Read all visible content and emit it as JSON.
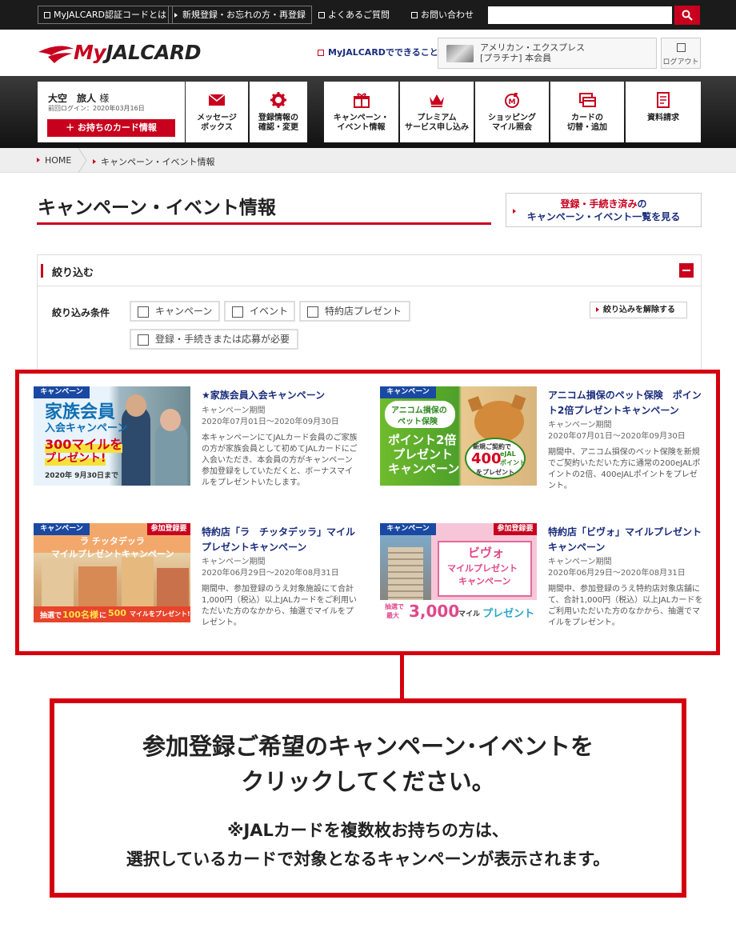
{
  "topbar": {
    "auth_code": "MyJALCARD認証コードとは",
    "register": "新規登録・お忘れの方・再登録",
    "faq": "よくあるご質問",
    "contact": "お問い合わせ",
    "search_placeholder": ""
  },
  "header": {
    "logo_my": "My",
    "logo_jal": "JALCARD",
    "can_do": "MyJALCARDでできること",
    "card_name": "アメリカン・エクスプレス",
    "card_grade": "[プラチナ] 本会員",
    "logout": "ログアウト"
  },
  "user": {
    "name": "大空　旅人",
    "honorific": "様",
    "last_login": "前回ログイン：2020年03月16日",
    "card_info_button": "＋ お持ちのカード情報"
  },
  "nav": [
    {
      "line1": "メッセージ",
      "line2": "ボックス",
      "icon": "envelope-icon"
    },
    {
      "line1": "登録情報の",
      "line2": "確認・変更",
      "icon": "gear-icon"
    },
    {
      "line1": "キャンペーン・",
      "line2": "イベント情報",
      "icon": "gift-icon"
    },
    {
      "line1": "プレミアム",
      "line2": "サービス申し込み",
      "icon": "crown-icon"
    },
    {
      "line1": "ショッピング",
      "line2": "マイル照会",
      "icon": "shopping-bag-icon"
    },
    {
      "line1": "カードの",
      "line2": "切替・追加",
      "icon": "cards-icon"
    },
    {
      "line1": "資料請求",
      "line2": "",
      "icon": "document-icon"
    }
  ],
  "breadcrumb": {
    "home": "HOME",
    "current": "キャンペーン・イベント情報"
  },
  "page": {
    "title": "キャンペーン・イベント情報",
    "registered_link_red": "登録・手続き済み",
    "registered_link_suffix": "の",
    "registered_link_line2": "キャンペーン・イベント一覧を見る"
  },
  "filter": {
    "title": "絞り込む",
    "condition_label": "絞り込み条件",
    "options": [
      "キャンペーン",
      "イベント",
      "特約店プレゼント",
      "登録・手続きまたは応募が必要"
    ],
    "clear_button": "絞り込みを解除する"
  },
  "campaigns": [
    {
      "tag": "キャンペーン",
      "tag_required": "",
      "title": "★家族会員入会キャンペーン",
      "period_label": "キャンペーン期間",
      "period": "2020年07月01日～2020年09月30日",
      "description": "本キャンペーンにてJALカード会員のご家族の方が家族会員として初めてJALカードにご入会いただき、本会員の方がキャンペーン参加登録をしていただくと、ボーナスマイルをプレゼントいたします。",
      "banner": [
        "家族会員",
        "入会キャンペーン",
        "300マイルを",
        "プレゼント!",
        "2020年 9月30日まで"
      ]
    },
    {
      "tag": "キャンペーン",
      "tag_required": "",
      "title": "アニコム損保のペット保険　ポイント2倍プレゼントキャンペーン",
      "period_label": "キャンペーン期間",
      "period": "2020年07月01日～2020年09月30日",
      "description": "期間中、アニコム損保のペット保険を新規でご契約いただいた方に通常の200eJALポイントの2倍、400eJALポイントをプレゼント。",
      "banner": [
        "アニコム損保の",
        "ペット保険",
        "ポイント2倍",
        "プレゼント",
        "キャンペーン",
        "新規ご契約で",
        "400",
        "eJAL",
        "ポイント",
        "をプレゼント"
      ]
    },
    {
      "tag": "キャンペーン",
      "tag_required": "参加登録要",
      "title": "特約店「ラ　チッタデッラ」マイルプレゼントキャンペーン",
      "period_label": "キャンペーン期間",
      "period": "2020年06月29日～2020年08月31日",
      "description": "期間中、参加登録のうえ対象施設にて合計1,000円（税込）以上JALカードをご利用いただいた方のなかから、抽選でマイルをプレゼント。",
      "banner": [
        "ラ チッタデッラ",
        "マイルプレゼントキャンペーン",
        "抽選で",
        "100名様",
        "に",
        "500",
        "マイルをプレゼント!"
      ]
    },
    {
      "tag": "キャンペーン",
      "tag_required": "参加登録要",
      "title": "特約店「ビヴォ」マイルプレゼントキャンペーン",
      "period_label": "キャンペーン期間",
      "period": "2020年06月29日～2020年08月31日",
      "description": "期間中、参加登録のうえ特約店対象店舗にて、合計1,000円（税込）以上JALカードをご利用いただいた方のなかから、抽選でマイルをプレゼント。",
      "banner": [
        "ビヴォ",
        "マイルプレゼント",
        "キャンペーン",
        "抽選で",
        "最大",
        "3,000",
        "マイル",
        "プレゼント"
      ]
    }
  ],
  "note": {
    "line1": "参加登録ご希望のキャンペーン･イベントを",
    "line2": "クリックしてください。",
    "sub1": "※JALカードを複数枚お持ちの方は、",
    "sub2": "選択しているカードで対象となるキャンペーンが表示されます。"
  },
  "colors": {
    "brand_red": "#c8001e",
    "frame_red": "#d5000f",
    "tag_blue": "#1a49a3",
    "link_navy": "#1a2c7c"
  }
}
